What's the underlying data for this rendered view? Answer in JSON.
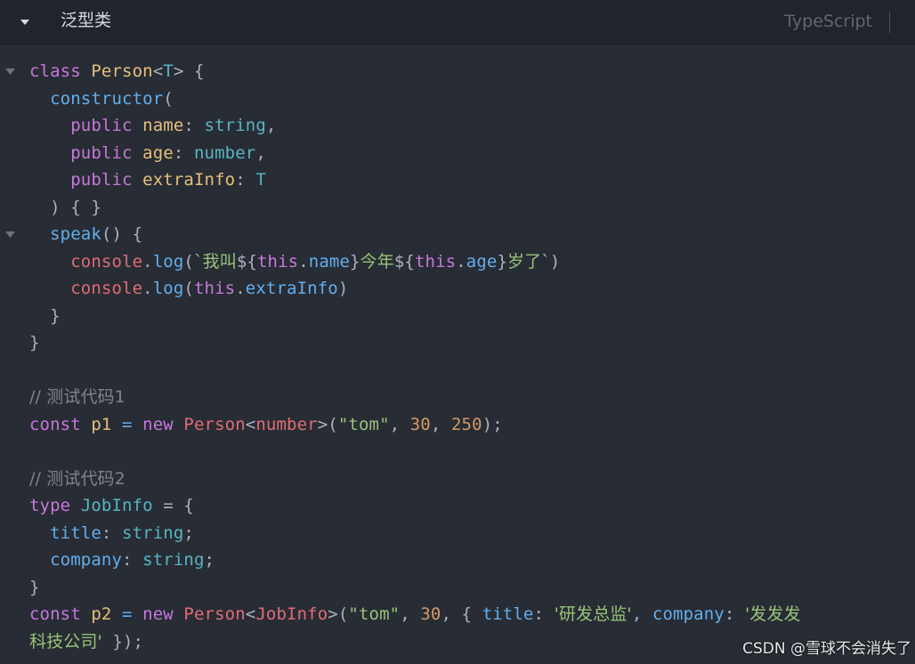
{
  "header": {
    "title": "泛型类",
    "language": "TypeScript"
  },
  "watermark": "CSDN @雪球不会消失了",
  "colors": {
    "background": "#282c34",
    "header_background": "#21252b",
    "keyword": "#c678dd",
    "class_name": "#e5c07b",
    "type": "#56b6c2",
    "function": "#61afef",
    "string": "#98c379",
    "number": "#d19a66",
    "comment": "#7f848e",
    "object": "#e06c75"
  },
  "icons": {
    "collapse": "chevron-down-icon",
    "fold": "fold-triangle-icon"
  },
  "code": {
    "l1": [
      "class",
      " ",
      "Person",
      "<",
      "T",
      "> {"
    ],
    "l2": [
      "  ",
      "constructor",
      "("
    ],
    "l3": [
      "    ",
      "public",
      " ",
      "name",
      ": ",
      "string",
      ","
    ],
    "l4": [
      "    ",
      "public",
      " ",
      "age",
      ": ",
      "number",
      ","
    ],
    "l5": [
      "    ",
      "public",
      " ",
      "extraInfo",
      ": ",
      "T"
    ],
    "l6": [
      "  ) { }"
    ],
    "l7": [
      "  ",
      "speak",
      "() {"
    ],
    "l8": [
      "    ",
      "console",
      ".",
      "log",
      "(",
      "`我叫",
      "${",
      "this",
      ".",
      "name",
      "}",
      "今年",
      "${",
      "this",
      ".",
      "age",
      "}",
      "岁了`",
      ")"
    ],
    "l9": [
      "    ",
      "console",
      ".",
      "log",
      "(",
      "this",
      ".",
      "extraInfo",
      ")"
    ],
    "l10": [
      "  }"
    ],
    "l11": [
      "}"
    ],
    "l12": [
      ""
    ],
    "l13": [
      "// 测试代码1"
    ],
    "l14": [
      "const",
      " ",
      "p1",
      " = ",
      "new",
      " ",
      "Person",
      "<",
      "number",
      ">",
      "(",
      "\"tom\"",
      ", ",
      "30",
      ", ",
      "250",
      ");"
    ],
    "l15": [
      ""
    ],
    "l16": [
      "// 测试代码2"
    ],
    "l17": [
      "type",
      " ",
      "JobInfo",
      " = {"
    ],
    "l18": [
      "  ",
      "title",
      ": ",
      "string",
      ";"
    ],
    "l19": [
      "  ",
      "company",
      ": ",
      "string",
      ";"
    ],
    "l20": [
      "}"
    ],
    "l21": [
      "const",
      " ",
      "p2",
      " = ",
      "new",
      " ",
      "Person",
      "<",
      "JobInfo",
      ">",
      "(",
      "\"tom\"",
      ", ",
      "30",
      ", { ",
      "title",
      ": ",
      "'研发总监'",
      ", ",
      "company",
      ": ",
      "'发发发"
    ],
    "l22": [
      "科技公司'",
      " });"
    ]
  }
}
